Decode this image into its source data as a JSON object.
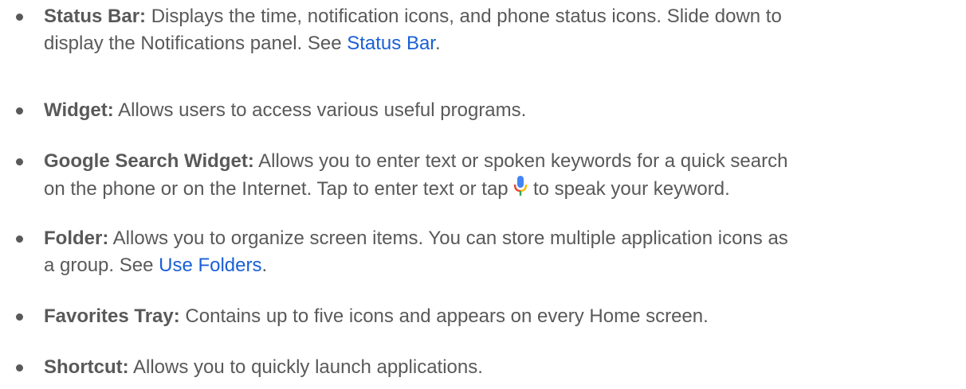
{
  "items": [
    {
      "label": "Status Bar:",
      "line1": "Displays the time, notification icons, and phone status icons. Slide down to",
      "line2_prefix": "display the Notifications panel. See ",
      "link": "Status Bar",
      "line2_suffix": "."
    },
    {
      "label": "Widget:",
      "text": "Allows users to access various useful programs."
    },
    {
      "label": "Google Search Widget:",
      "line1": "Allows you to enter text or spoken keywords for a quick search",
      "line2_prefix": "on the phone or on the Internet. Tap to enter text or tap ",
      "icon": "microphone-icon",
      "line2_suffix": " to speak your keyword."
    },
    {
      "label": "Folder:",
      "line1": "Allows you to organize screen items. You can store multiple application icons as",
      "line2_prefix": "a group. See ",
      "link": "Use Folders",
      "line2_suffix": "."
    },
    {
      "label": "Favorites Tray:",
      "text": "Contains up to five icons and appears on every Home screen."
    },
    {
      "label": "Shortcut:",
      "text": "Allows you to quickly launch applications."
    }
  ],
  "colors": {
    "text": "#595959",
    "link": "#1a5fd6",
    "mic_blue": "#4285f4",
    "mic_red": "#ea4335",
    "mic_yellow": "#fbbc05",
    "mic_green": "#34a853"
  }
}
